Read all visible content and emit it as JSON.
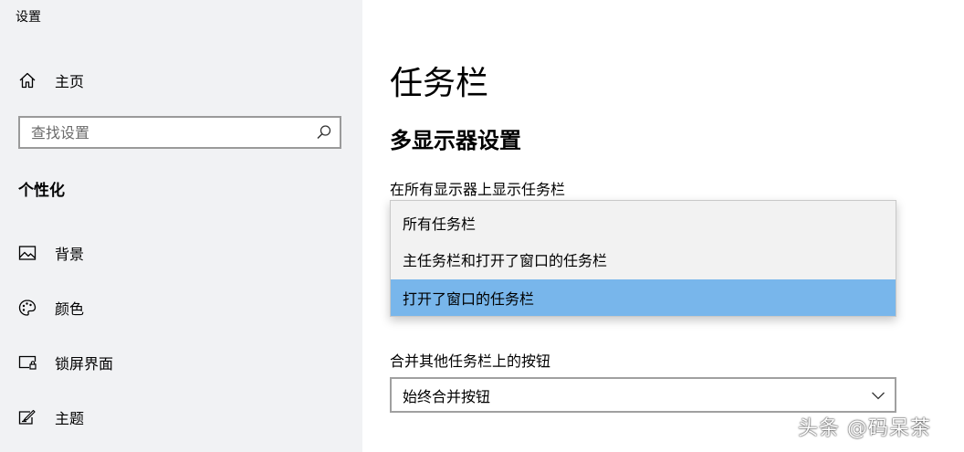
{
  "window": {
    "title": "设置"
  },
  "sidebar": {
    "home": {
      "label": "主页",
      "icon": "home-icon"
    },
    "search": {
      "placeholder": "查找设置",
      "value": "",
      "icon": "search-icon"
    },
    "section_heading": "个性化",
    "items": [
      {
        "label": "背景",
        "icon": "picture-icon"
      },
      {
        "label": "颜色",
        "icon": "palette-icon"
      },
      {
        "label": "锁屏界面",
        "icon": "lock-screen-icon"
      },
      {
        "label": "主题",
        "icon": "theme-icon"
      }
    ]
  },
  "main": {
    "title": "任务栏",
    "subsection": "多显示器设置",
    "show_taskbar": {
      "label": "在所有显示器上显示任务栏",
      "options": [
        "所有任务栏",
        "主任务栏和打开了窗口的任务栏",
        "打开了窗口的任务栏"
      ],
      "selected_index": 2
    },
    "combine_buttons": {
      "label": "合并其他任务栏上的按钮",
      "value": "始终合并按钮",
      "icon": "chevron-down-icon"
    }
  },
  "watermark": "头条 @码呆茶",
  "colors": {
    "sidebar_bg": "#f1f2f4",
    "selected_option_bg": "#78b6eb",
    "dropdown_bg": "#f2f2f2"
  }
}
